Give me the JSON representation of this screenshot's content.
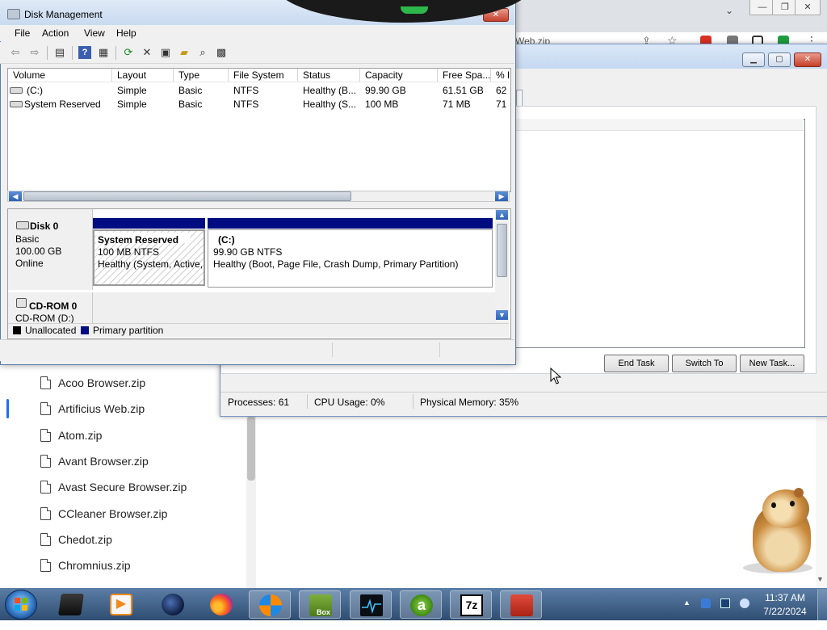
{
  "browser": {
    "address_text": "Web.zip",
    "files": [
      {
        "name": "Acoo Browser.zip",
        "selected": false
      },
      {
        "name": "Artificius Web.zip",
        "selected": true
      },
      {
        "name": "Atom.zip",
        "selected": false
      },
      {
        "name": "Avant Browser.zip",
        "selected": false
      },
      {
        "name": "Avast Secure Browser.zip",
        "selected": false
      },
      {
        "name": "CCleaner Browser.zip",
        "selected": false
      },
      {
        "name": "Chedot.zip",
        "selected": false
      },
      {
        "name": "Chromnius.zip",
        "selected": false
      }
    ]
  },
  "task_manager": {
    "buttons": {
      "end_task": "End Task",
      "switch_to": "Switch To",
      "new_task": "New Task..."
    },
    "status": {
      "processes": "Processes: 61",
      "cpu": "CPU Usage: 0%",
      "memory": "Physical Memory: 35%"
    }
  },
  "disk_management": {
    "title": "Disk Management",
    "menu": [
      "File",
      "Action",
      "View",
      "Help"
    ],
    "columns": [
      "Volume",
      "Layout",
      "Type",
      "File System",
      "Status",
      "Capacity",
      "Free Spa...",
      "% F"
    ],
    "volumes": [
      {
        "volume": "(C:)",
        "layout": "Simple",
        "type": "Basic",
        "fs": "NTFS",
        "status": "Healthy (B...",
        "capacity": "99.90 GB",
        "free": "61.51 GB",
        "pct": "62"
      },
      {
        "volume": "System Reserved",
        "layout": "Simple",
        "type": "Basic",
        "fs": "NTFS",
        "status": "Healthy (S...",
        "capacity": "100 MB",
        "free": "71 MB",
        "pct": "71"
      }
    ],
    "disk0": {
      "name": "Disk 0",
      "type": "Basic",
      "size": "100.00 GB",
      "state": "Online"
    },
    "partitions": {
      "system_reserved": {
        "name": "System Reserved",
        "size": "100 MB NTFS",
        "status": "Healthy (System, Active,"
      },
      "c_drive": {
        "name": "(C:)",
        "size": "99.90 GB NTFS",
        "status": "Healthy (Boot, Page File, Crash Dump, Primary Partition)"
      }
    },
    "cdrom": {
      "name": "CD-ROM 0",
      "drive": "CD-ROM (D:)"
    },
    "legend": {
      "unallocated": "Unallocated",
      "primary": "Primary partition"
    }
  },
  "taskbar": {
    "time": "11:37 AM",
    "date": "7/22/2024",
    "apps": [
      "terminal-app",
      "media-player",
      "globe-app",
      "firefox",
      "browser-circle",
      "box-app",
      "monitor-app",
      "browser-a",
      "7zip",
      "toolbox-app"
    ]
  },
  "colors": {
    "primary_partition": "#000c80",
    "accent_blue": "#1a73e8",
    "taskbar": "#3f6189"
  }
}
